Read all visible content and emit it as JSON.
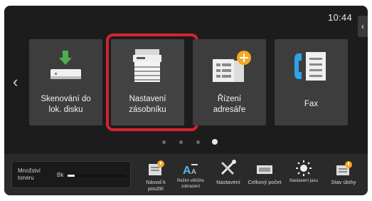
{
  "status": {
    "time": "10:44"
  },
  "nav": {
    "back_glyph": "‹",
    "prev_glyph": "‹"
  },
  "tiles": [
    {
      "label_line1": "Skenování do",
      "label_line2": "lok. disku",
      "icon": "scan-to-disk-icon"
    },
    {
      "label_line1": "Nastavení",
      "label_line2": "zásobníku",
      "icon": "printer-tray-icon",
      "selected": true
    },
    {
      "label_line1": "Řízení",
      "label_line2": "adresáře",
      "icon": "address-book-icon"
    },
    {
      "label_line1": "Fax",
      "label_line2": "",
      "icon": "fax-icon"
    }
  ],
  "pager": {
    "pages": 4,
    "active": 4
  },
  "toner": {
    "title_line1": "Množství",
    "title_line2": "toneru",
    "channel": "Bk",
    "level_fraction": 0.12
  },
  "shortcuts": [
    {
      "label": "Návod k použití",
      "icon": "manual-icon"
    },
    {
      "label": "Režim většího zobrazení",
      "icon": "text-size-icon"
    },
    {
      "label": "Nastavení",
      "icon": "settings-tools-icon"
    },
    {
      "label": "Celkový počet",
      "icon": "counter-icon"
    },
    {
      "label": "Nastavení jasu",
      "icon": "brightness-icon"
    },
    {
      "label": "Stav úlohy",
      "icon": "job-status-icon"
    }
  ],
  "colors": {
    "screen_bg": "#1c1c1c",
    "tile_bg": "#3d3d3d",
    "highlight": "#d6232f",
    "accent_blue": "#2ea3e6",
    "accent_orange": "#f5a623",
    "accent_green": "#4caf50"
  }
}
